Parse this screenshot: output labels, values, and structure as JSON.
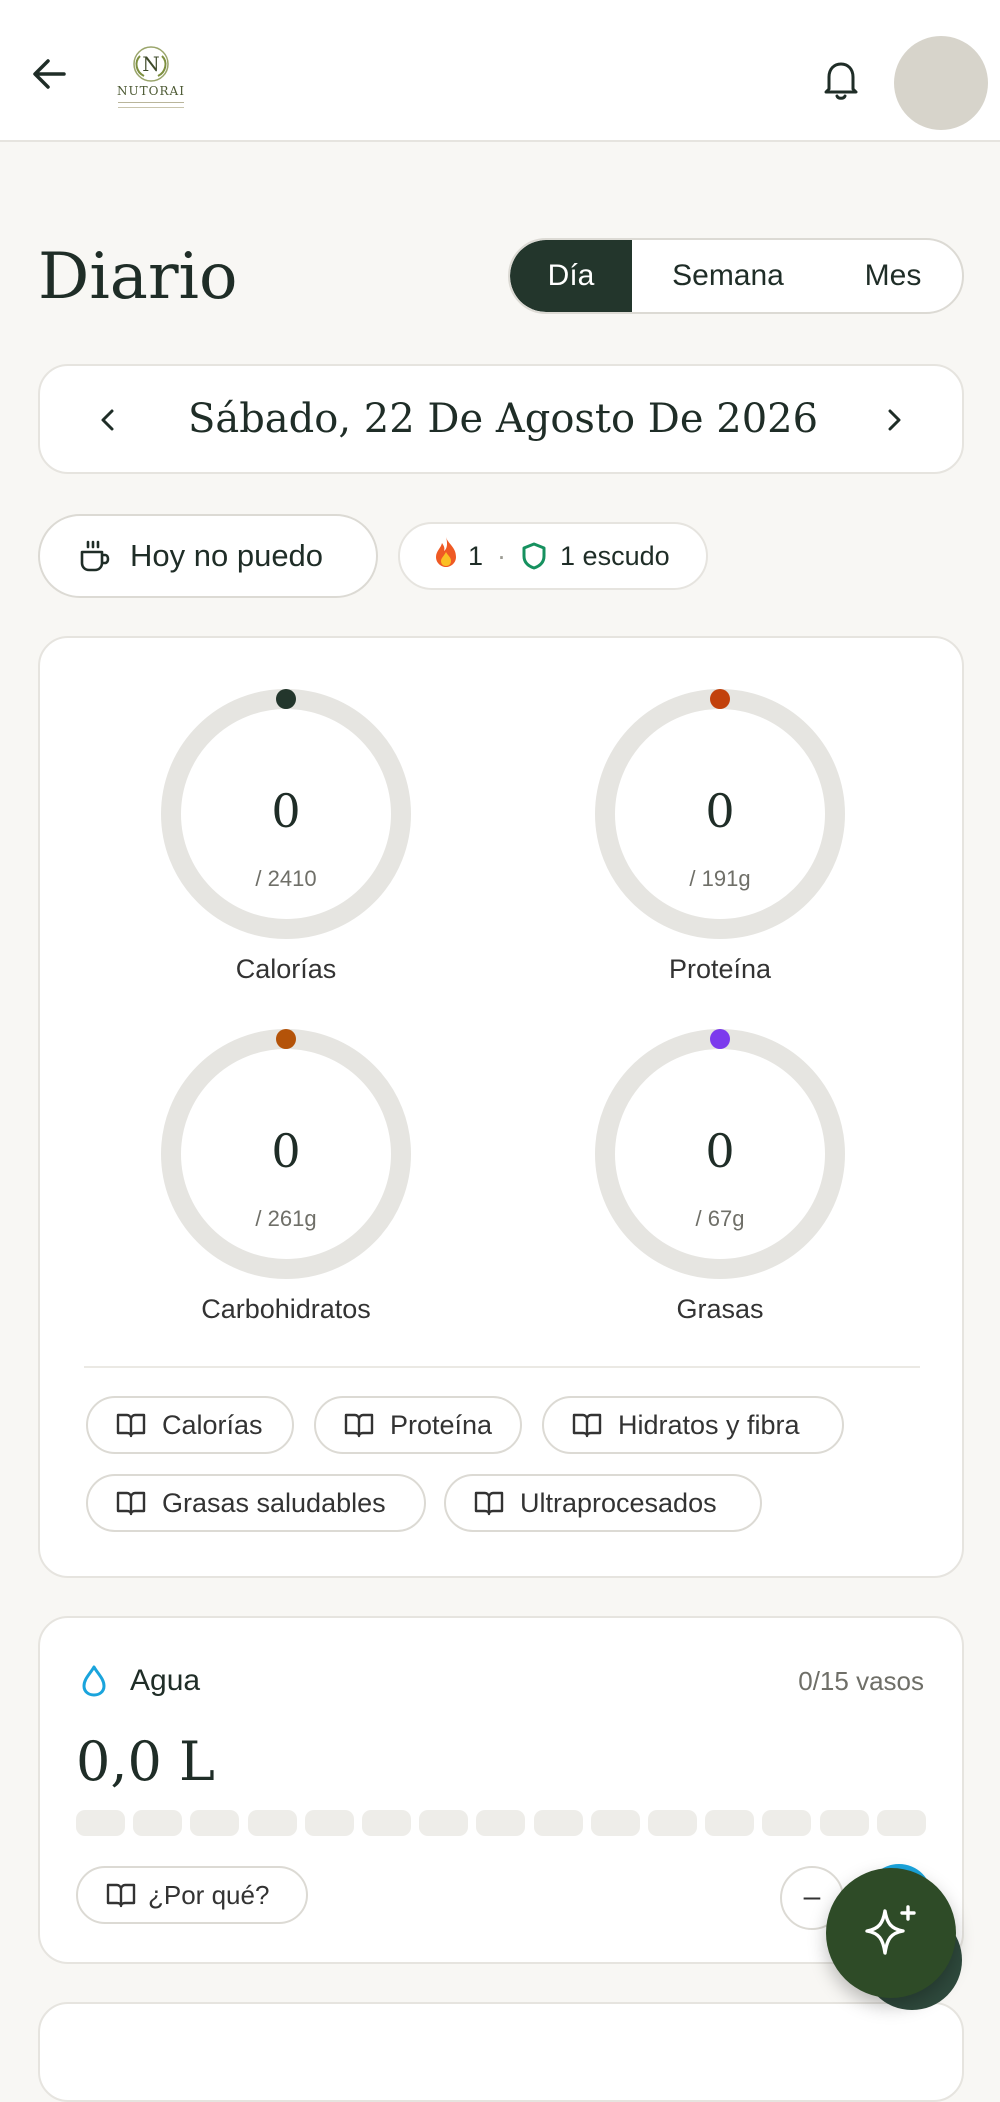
{
  "header": {
    "logo_text": "NUTORAI"
  },
  "title": "Diario",
  "view_tabs": [
    {
      "label": "Día",
      "active": true
    },
    {
      "label": "Semana",
      "active": false
    },
    {
      "label": "Mes",
      "active": false
    }
  ],
  "date": {
    "label": "Sábado, 22 De Agosto De 2026"
  },
  "skip_button": {
    "label": "Hoy no puedo"
  },
  "streak": {
    "days": "1",
    "separator": "·",
    "shields_label": "1 escudo"
  },
  "macros": [
    {
      "name": "Calorías",
      "value": "0",
      "goal": "/ 2410",
      "progress": 0,
      "color": "#23362c"
    },
    {
      "name": "Proteína",
      "value": "0",
      "goal": "/ 191g",
      "progress": 0,
      "color": "#c2410c"
    },
    {
      "name": "Carbohidratos",
      "value": "0",
      "goal": "/ 261g",
      "progress": 0,
      "color": "#b45309"
    },
    {
      "name": "Grasas",
      "value": "0",
      "goal": "/ 67g",
      "progress": 0,
      "color": "#7c3aed"
    }
  ],
  "guides": [
    {
      "label": "Calorías"
    },
    {
      "label": "Proteína"
    },
    {
      "label": "Hidratos y fibra"
    },
    {
      "label": "Grasas saludables"
    },
    {
      "label": "Ultraprocesados"
    }
  ],
  "water": {
    "title": "Agua",
    "count": "0/15 vasos",
    "liters": "0,0 L",
    "glasses_total": 15,
    "glasses_filled": 0,
    "why_label": "¿Por qué?",
    "minus_label": "–"
  },
  "colors": {
    "primary": "#23362c",
    "fab": "#2e4b27",
    "water": "#1aa4dc",
    "ring_track": "#e6e5e1"
  },
  "icons": {
    "back": "arrow-left-icon",
    "bell": "bell-icon",
    "flame": "flame-icon",
    "shield": "shield-icon",
    "book": "book-open-icon",
    "water": "droplet-icon",
    "sparkle": "sparkles-icon"
  }
}
